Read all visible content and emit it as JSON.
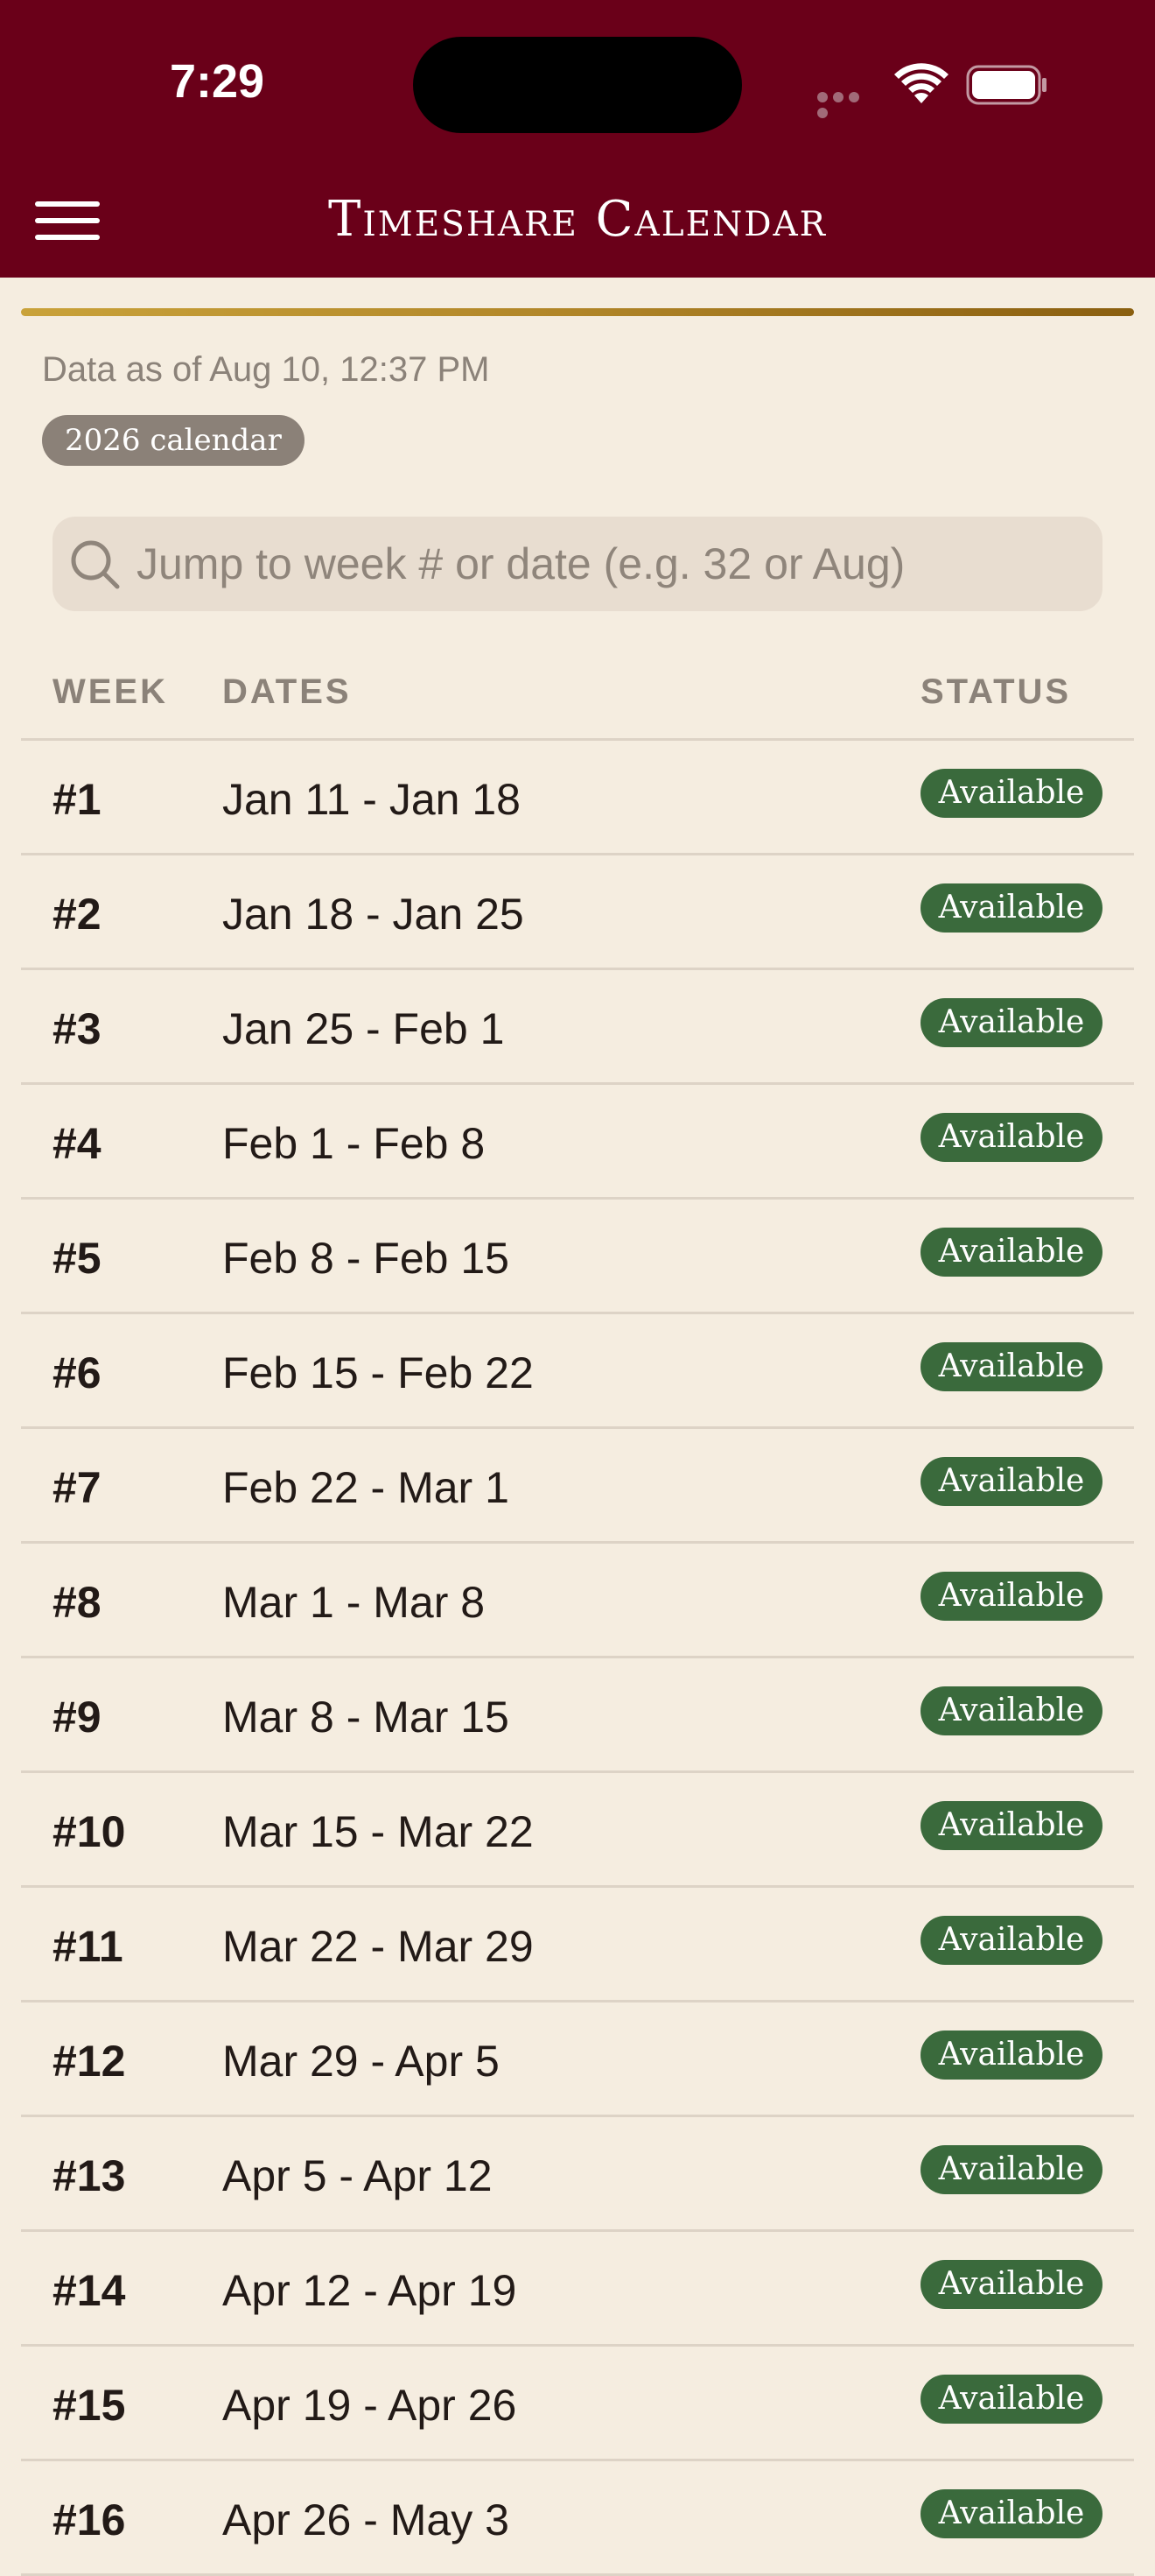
{
  "status_bar": {
    "time": "7:29"
  },
  "header": {
    "title": "Timeshare Calendar",
    "bg_color": "#6a0019"
  },
  "meta": {
    "data_as_of": "Data as of Aug 10, 12:37 PM",
    "calendar_badge": "2026 calendar"
  },
  "search": {
    "placeholder": "Jump to week # or date (e.g. 32 or Aug)",
    "value": ""
  },
  "table": {
    "columns": {
      "week": "WEEK",
      "dates": "DATES",
      "status": "STATUS"
    },
    "status_color": "#3a6a3c",
    "rows": [
      {
        "week": "#1",
        "dates": "Jan 11 - Jan 18",
        "status": "Available"
      },
      {
        "week": "#2",
        "dates": "Jan 18 - Jan 25",
        "status": "Available"
      },
      {
        "week": "#3",
        "dates": "Jan 25 - Feb 1",
        "status": "Available"
      },
      {
        "week": "#4",
        "dates": "Feb 1 - Feb 8",
        "status": "Available"
      },
      {
        "week": "#5",
        "dates": "Feb 8 - Feb 15",
        "status": "Available"
      },
      {
        "week": "#6",
        "dates": "Feb 15 - Feb 22",
        "status": "Available"
      },
      {
        "week": "#7",
        "dates": "Feb 22 - Mar 1",
        "status": "Available"
      },
      {
        "week": "#8",
        "dates": "Mar 1 - Mar 8",
        "status": "Available"
      },
      {
        "week": "#9",
        "dates": "Mar 8 - Mar 15",
        "status": "Available"
      },
      {
        "week": "#10",
        "dates": "Mar 15 - Mar 22",
        "status": "Available"
      },
      {
        "week": "#11",
        "dates": "Mar 22 - Mar 29",
        "status": "Available"
      },
      {
        "week": "#12",
        "dates": "Mar 29 - Apr 5",
        "status": "Available"
      },
      {
        "week": "#13",
        "dates": "Apr 5 - Apr 12",
        "status": "Available"
      },
      {
        "week": "#14",
        "dates": "Apr 12 - Apr 19",
        "status": "Available"
      },
      {
        "week": "#15",
        "dates": "Apr 19 - Apr 26",
        "status": "Available"
      },
      {
        "week": "#16",
        "dates": "Apr 26 - May 3",
        "status": "Available"
      }
    ]
  }
}
